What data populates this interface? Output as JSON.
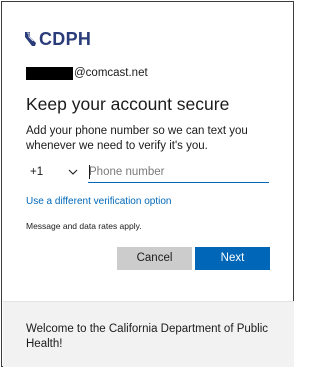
{
  "brand": {
    "logo_text": "CDPH",
    "logo_color": "#2a3d7a"
  },
  "account": {
    "domain": "@comcast.net"
  },
  "title": "Keep your account secure",
  "description": "Add your phone number so we can text you whenever we need to verify it's you.",
  "phone": {
    "country_code": "+1",
    "placeholder": "Phone number",
    "value": ""
  },
  "alt_link": "Use a different verification option",
  "note": "Message and data rates apply.",
  "buttons": {
    "cancel": "Cancel",
    "next": "Next"
  },
  "footer": {
    "text": "Welcome to the California Department of Public Health!"
  },
  "colors": {
    "accent": "#0067b8",
    "cancel_bg": "#cccccc",
    "footer_bg": "#f2f2f2"
  }
}
